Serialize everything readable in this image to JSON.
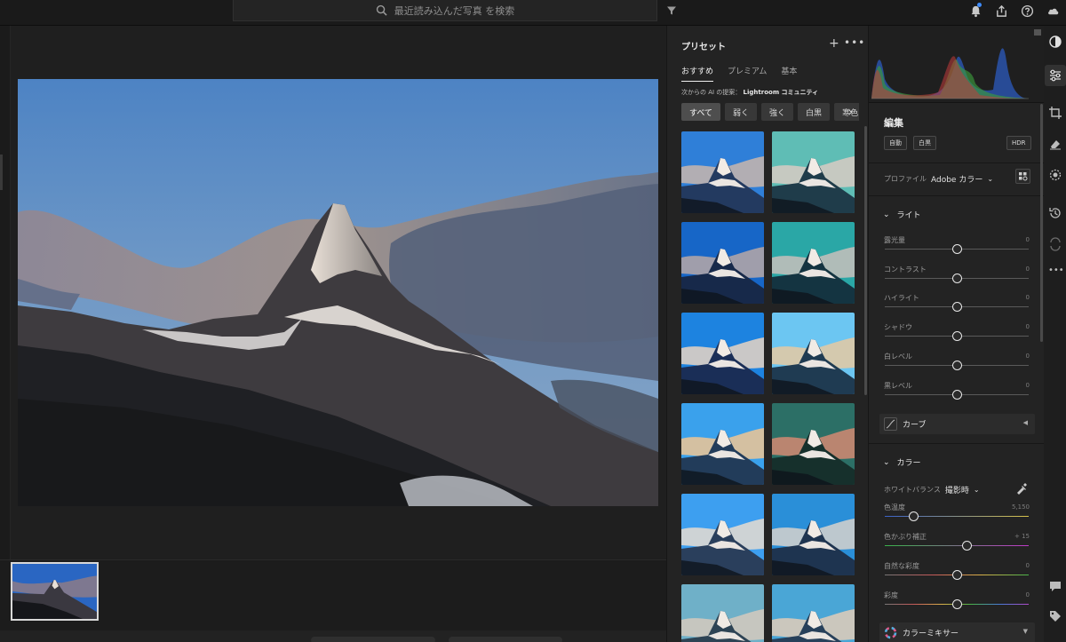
{
  "search": {
    "placeholder": "最近読み込んだ写真 を検索"
  },
  "presets": {
    "title": "プリセット",
    "tabs": [
      {
        "label": "おすすめ",
        "active": true
      },
      {
        "label": "プレミアム",
        "active": false
      },
      {
        "label": "基本",
        "active": false
      }
    ],
    "ai_prefix": "次からの AI の提案：",
    "ai_source": "Lightroom コミュニティ",
    "chips": [
      "すべて",
      "弱く",
      "強く",
      "白黒",
      "寒色"
    ],
    "selected_chip": "すべて"
  },
  "edit": {
    "title": "編集",
    "buttons": {
      "auto": "自動",
      "bw": "白黒",
      "hdr": "HDR"
    },
    "profile_label": "プロファイル",
    "profile_value": "Adobe カラー",
    "light": {
      "title": "ライト",
      "sliders": [
        {
          "label": "露光量",
          "value": "0",
          "pos": 0.5
        },
        {
          "label": "コントラスト",
          "value": "0",
          "pos": 0.5
        },
        {
          "label": "ハイライト",
          "value": "0",
          "pos": 0.5
        },
        {
          "label": "シャドウ",
          "value": "0",
          "pos": 0.5
        },
        {
          "label": "白レベル",
          "value": "0",
          "pos": 0.5
        },
        {
          "label": "黒レベル",
          "value": "0",
          "pos": 0.5
        }
      ],
      "curve": "カーブ"
    },
    "color": {
      "title": "カラー",
      "wb_label": "ホワイトバランス",
      "wb_value": "撮影時",
      "sliders": [
        {
          "label": "色温度",
          "value": "5,150",
          "pos": 0.2
        },
        {
          "label": "色かぶり補正",
          "value": "+ 15",
          "pos": 0.57
        },
        {
          "label": "自然な彩度",
          "value": "0",
          "pos": 0.5
        },
        {
          "label": "彩度",
          "value": "0",
          "pos": 0.5
        }
      ],
      "mixer": "カラーミキサー"
    }
  },
  "colors": {
    "accent": "#3e8cff",
    "panel": "#232323",
    "background": "#1e1e1e"
  }
}
